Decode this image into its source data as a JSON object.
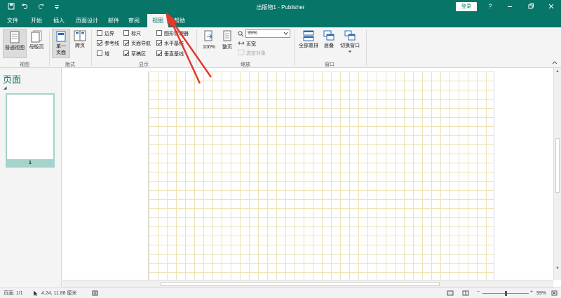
{
  "window": {
    "title": "出版物1  -  Publisher",
    "login_label": "登录",
    "help_label": "?",
    "icons": [
      "save-icon",
      "undo-icon",
      "redo-icon",
      "customize-qat-icon",
      "ribbon-display-icon",
      "minimize-icon",
      "restore-icon",
      "close-icon"
    ]
  },
  "tabs": [
    {
      "label": "文件"
    },
    {
      "label": "开始"
    },
    {
      "label": "插入"
    },
    {
      "label": "页面设计"
    },
    {
      "label": "邮件"
    },
    {
      "label": "审阅"
    },
    {
      "label": "视图",
      "active": true
    },
    {
      "label": "帮助"
    }
  ],
  "ribbon": {
    "views": {
      "label": "视图",
      "normal": "普通视图",
      "master": "母版页"
    },
    "layout": {
      "label": "版式",
      "single_line1": "单一",
      "single_line2": "页面",
      "spread": "跨页"
    },
    "show": {
      "label": "显示",
      "checks": [
        {
          "label": "边界",
          "checked": false
        },
        {
          "label": "参考线",
          "checked": true
        },
        {
          "label": "域",
          "checked": false
        },
        {
          "label": "标尺",
          "checked": false
        },
        {
          "label": "页面导航",
          "checked": true
        },
        {
          "label": "草稿区",
          "checked": true
        },
        {
          "label": "图形管理器",
          "checked": false
        },
        {
          "label": "水平基线",
          "checked": true
        },
        {
          "label": "垂直基线",
          "checked": true
        }
      ]
    },
    "zoom": {
      "label": "缩放",
      "hundred": "100%",
      "whole_page": "整页",
      "zoom_value": "99%",
      "page_width": "页宽",
      "selected_objects": "选定对象"
    },
    "window": {
      "label": "窗口",
      "arrange_all": "全部重排",
      "cascade": "层叠",
      "switch_windows": "切换窗口"
    }
  },
  "pages_pane": {
    "title": "页面",
    "thumb_number": "1"
  },
  "status": {
    "page": "页面: 1/1",
    "position": "4.24, 11.88 厘米",
    "zoom": "99%",
    "zoom_fraction": 0.5
  },
  "colors": {
    "accent": "#077568",
    "annotation_arrow": "#e03a2f",
    "grid": "#ece3b7"
  }
}
